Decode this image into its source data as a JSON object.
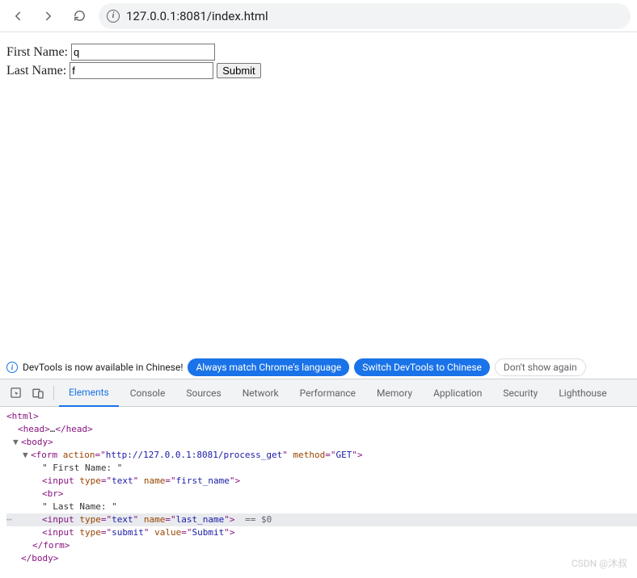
{
  "browser": {
    "url": "127.0.0.1:8081/index.html"
  },
  "page": {
    "first_label": "First Name: ",
    "last_label": "Last Name: ",
    "first_value": "q",
    "last_value": "f",
    "submit_label": "Submit"
  },
  "banner": {
    "text": "DevTools is now available in Chinese!",
    "match": "Always match Chrome's language",
    "switch": "Switch DevTools to Chinese",
    "dont": "Don't show again"
  },
  "devtools": {
    "tabs": {
      "elements": "Elements",
      "console": "Console",
      "sources": "Sources",
      "network": "Network",
      "performance": "Performance",
      "memory": "Memory",
      "application": "Application",
      "security": "Security",
      "lighthouse": "Lighthouse"
    }
  },
  "dom": {
    "l0": "<html>",
    "l1_open": "<head>",
    "l1_mid": "…",
    "l1_close": "</head>",
    "l2": "<body>",
    "l3_a": "<form ",
    "l3_b": "action",
    "l3_c": "=\"",
    "l3_d": "http://127.0.0.1:8081/process_get",
    "l3_e": "\" ",
    "l3_f": "method",
    "l3_g": "=\"",
    "l3_h": "GET",
    "l3_i": "\">",
    "l4": "\" First Name: \"",
    "l5_a": "<input ",
    "l5_b": "type",
    "l5_c": "=\"",
    "l5_d": "text",
    "l5_e": "\" ",
    "l5_f": "name",
    "l5_g": "=\"",
    "l5_h": "first_name",
    "l5_i": "\">",
    "l6": "<br>",
    "l7": "\" Last Name: \"",
    "l8_a": "<input ",
    "l8_b": "type",
    "l8_c": "=\"",
    "l8_d": "text",
    "l8_e": "\" ",
    "l8_f": "name",
    "l8_g": "=\"",
    "l8_h": "last_name",
    "l8_i": "\">",
    "l8_eq": " == $0",
    "l9_a": "<input ",
    "l9_b": "type",
    "l9_c": "=\"",
    "l9_d": "submit",
    "l9_e": "\" ",
    "l9_f": "value",
    "l9_g": "=\"",
    "l9_h": "Submit",
    "l9_i": "\">",
    "l10": "</form>",
    "l11": "</body>"
  },
  "watermark": "CSDN @沐叔"
}
